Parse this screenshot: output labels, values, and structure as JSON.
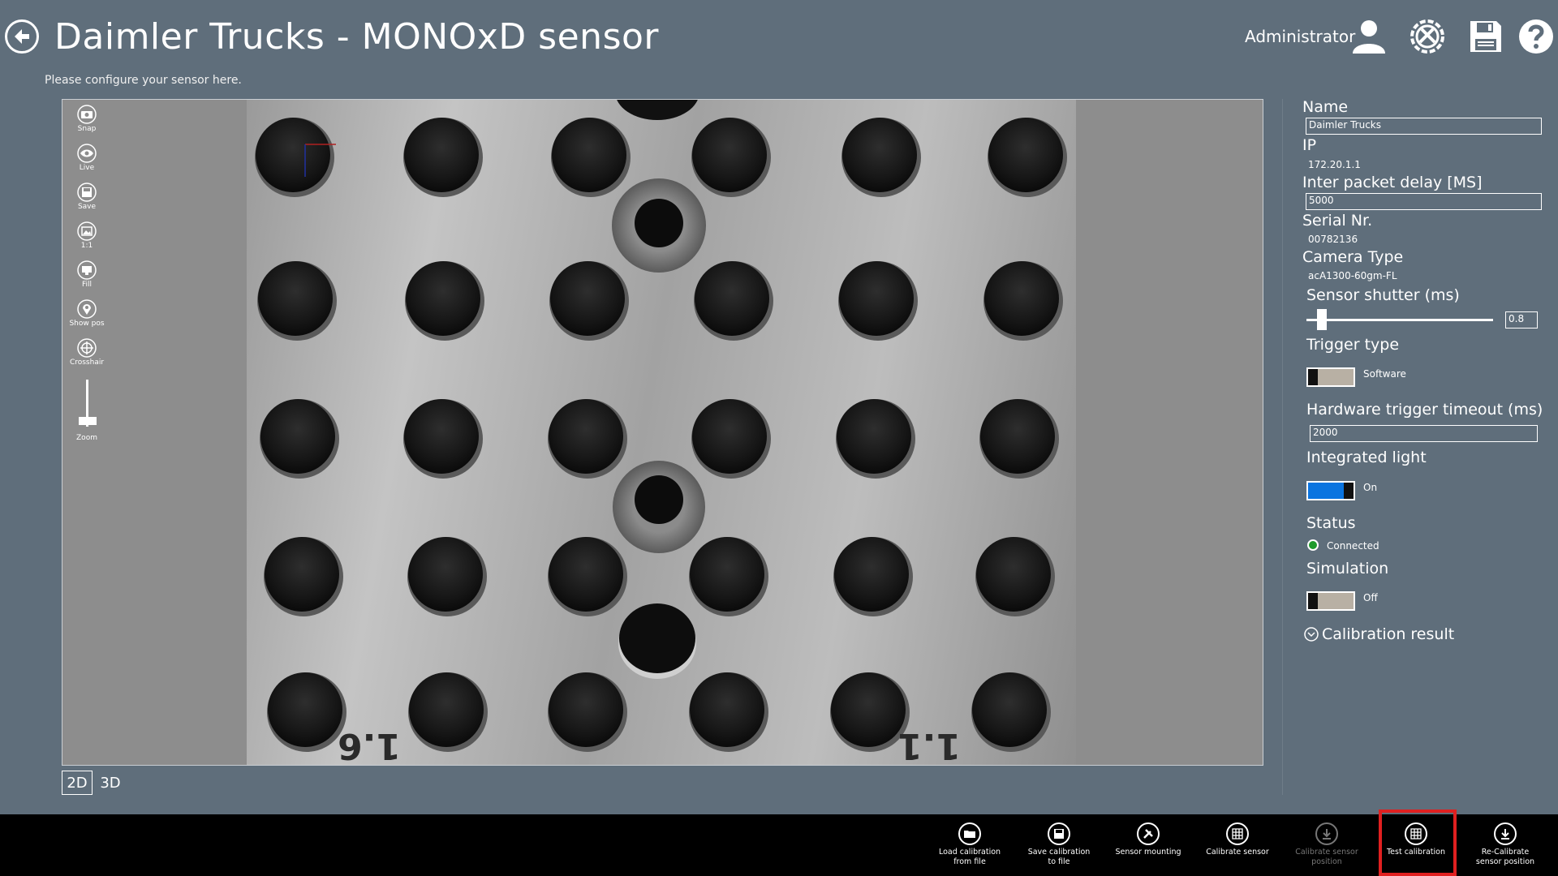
{
  "header": {
    "title": "Daimler Trucks - MONOxD sensor",
    "subtitle": "Please configure your sensor here.",
    "user": "Administrator",
    "icons": [
      "back-arrow-icon",
      "user-icon",
      "tools-settings-icon",
      "save-disk-icon",
      "help-icon"
    ]
  },
  "viewer": {
    "tools": [
      {
        "label": "Snap",
        "icon": "camera-icon"
      },
      {
        "label": "Live",
        "icon": "eye-icon"
      },
      {
        "label": "Save",
        "icon": "save-disk-icon"
      },
      {
        "label": "1:1",
        "icon": "image-icon"
      },
      {
        "label": "Fill",
        "icon": "monitor-icon"
      },
      {
        "label": "Show pos",
        "icon": "map-pin-icon"
      },
      {
        "label": "Crosshair",
        "icon": "crosshair-icon"
      }
    ],
    "zoom_label": "Zoom",
    "plate_marks": {
      "left": "1.6",
      "right": "1.1"
    },
    "view_tabs": [
      "2D",
      "3D"
    ],
    "active_tab": "2D"
  },
  "panel": {
    "name_label": "Name",
    "name_value": "Daimler Trucks",
    "ip_label": "IP",
    "ip_value": "172.20.1.1",
    "ipd_label": "Inter packet delay [MS]",
    "ipd_value": "5000",
    "serial_label": "Serial Nr.",
    "serial_value": "00782136",
    "camera_label": "Camera Type",
    "camera_value": "acA1300-60gm-FL",
    "shutter_label": "Sensor shutter (ms)",
    "shutter_value": "0.8",
    "shutter_level": 0.06,
    "trigger_label": "Trigger type",
    "trigger_value": "Software",
    "hw_timeout_label": "Hardware trigger timeout (ms)",
    "hw_timeout_value": "2000",
    "light_label": "Integrated light",
    "light_value": "On",
    "status_label": "Status",
    "status_value": "Connected",
    "status_color": "#1e9b2b",
    "simulation_label": "Simulation",
    "simulation_value": "Off",
    "calibration_label": "Calibration result"
  },
  "appbar": {
    "buttons": [
      {
        "label": "Load calibration\nfrom file",
        "icon": "folder-icon",
        "enabled": true
      },
      {
        "label": "Save calibration\nto file",
        "icon": "save-disk-icon",
        "enabled": true
      },
      {
        "label": "Sensor mounting",
        "icon": "wrench-icon",
        "enabled": true
      },
      {
        "label": "Calibrate sensor",
        "icon": "grid-icon",
        "enabled": true
      },
      {
        "label": "Calibrate sensor\nposition",
        "icon": "download-icon",
        "enabled": false
      },
      {
        "label": "Test calibration",
        "icon": "grid-icon",
        "enabled": true
      },
      {
        "label": "Re-Calibrate\nsensor position",
        "icon": "download-icon",
        "enabled": true
      }
    ],
    "highlighted": "Test calibration",
    "highlight_color": "#e02020"
  }
}
